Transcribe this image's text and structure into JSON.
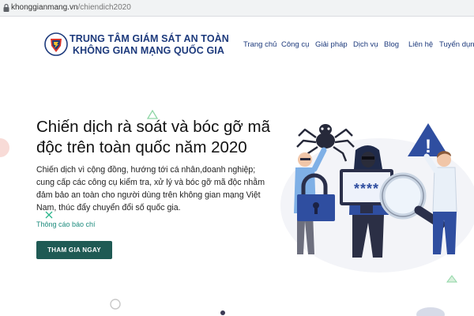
{
  "browser": {
    "url_host": "khonggianmang.vn",
    "url_path": "/chiendich2020"
  },
  "header": {
    "org_line1": "TRUNG TÂM GIÁM SÁT AN TOÀN",
    "org_line2": "KHÔNG GIAN MẠNG QUỐC GIA",
    "nav": [
      "Trang chủ",
      "Công cụ",
      "Giải pháp",
      "Dịch vụ",
      "Blog",
      "Liên hệ",
      "Tuyển dụng"
    ]
  },
  "hero": {
    "title_line1": "Chiến dịch rà soát và bóc gỡ mã",
    "title_line2": "độc trên toàn quốc năm 2020",
    "desc_line1": "Chiến dịch vì cộng đồng, hướng tới cá nhân,doanh nghiệp;",
    "desc_line2": "cung cấp các công cụ kiểm tra, xử lý và bóc gỡ mã độc nhằm",
    "desc_line3": "đảm bảo an toàn cho người dùng trên không gian mạng Việt",
    "desc_line4": "Nam, thúc đẩy chuyển đổi số quốc gia.",
    "press_link": "Thông cáo báo chí",
    "join_button": "THAM GIA NGAY",
    "password_mask": "****",
    "warning_mark": "!"
  },
  "colors": {
    "brand_navy": "#1d3a7c",
    "button_green": "#1f5a54",
    "link_teal": "#1e8c7e",
    "illustration_blue": "#2f4ea0"
  },
  "icons": [
    "lock-icon",
    "shield-logo-icon",
    "spider-icon",
    "warning-icon",
    "padlock-icon",
    "magnifier-icon"
  ]
}
